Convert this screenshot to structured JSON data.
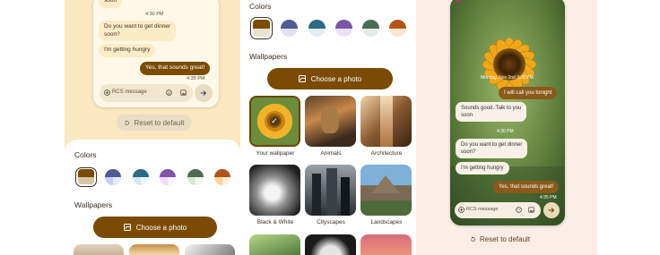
{
  "panel_left": {
    "chat": {
      "top_message": "soon",
      "ts1": "4:30 PM",
      "msg_dinner": "Do you want to get dinner\nsoon?",
      "msg_hungry": "I'm getting hungry",
      "msg_reply": "Yes, that sounds great!",
      "ts2": "4:35 PM",
      "input_placeholder": "RCS message"
    },
    "reset_label": "Reset to default",
    "colors_label": "Colors",
    "wallpapers_label": "Wallpapers",
    "choose_photo_label": "Choose a photo",
    "swatches": [
      {
        "top": "#7a4b03",
        "bottom": "#d7c7a4",
        "accent": "#d7c7a4"
      },
      {
        "top": "#525a93",
        "bottom": "#c6ceff",
        "accent": "#c6ceff"
      },
      {
        "top": "#2b6b86",
        "bottom": "#d8e6f3",
        "accent": "#e2f3fb"
      },
      {
        "top": "#7d54a6",
        "bottom": "#f2d7ff",
        "accent": "#f9f0ff"
      },
      {
        "top": "#4d6b53",
        "bottom": "#d9e8d9",
        "accent": "#eef5ee"
      },
      {
        "top": "#b3541b",
        "bottom": "#ffd49a",
        "accent": "#fff0d6"
      }
    ]
  },
  "panel_middle": {
    "colors_label": "Colors",
    "wallpapers_label": "Wallpapers",
    "choose_photo_label": "Choose a photo",
    "captions": [
      "Your wallpaper",
      "Animals",
      "Architecture",
      "Black & White",
      "Cityscapes",
      "Landscapes"
    ],
    "swatches": [
      {
        "top": "#7a4b03",
        "bottom": "#e9e1cf"
      },
      {
        "top": "#525a93",
        "bottom": "#e5e5f6"
      },
      {
        "top": "#2b6b86",
        "bottom": "#e7f0f4"
      },
      {
        "top": "#7d54a6",
        "bottom": "#efe6f8"
      },
      {
        "top": "#4d6b53",
        "bottom": "#e7efe8"
      },
      {
        "top": "#b3541b",
        "bottom": "#fbe8d8"
      }
    ]
  },
  "panel_right": {
    "date_stamp": "Monday, Nov 2nd  3:00 PM",
    "msg_call": "I will call you tonight",
    "msg_good": "Sounds good. Talk to you\nsoon",
    "ts1": "4:30 PM",
    "msg_dinner": "Do you want to get dinner\nsoon?",
    "msg_hungry": "I'm getting hungry",
    "msg_reply": "Yes, that sounds great!",
    "ts2": "4:35 PM",
    "input_placeholder": "RCS message",
    "reset_label": "Reset to default"
  }
}
